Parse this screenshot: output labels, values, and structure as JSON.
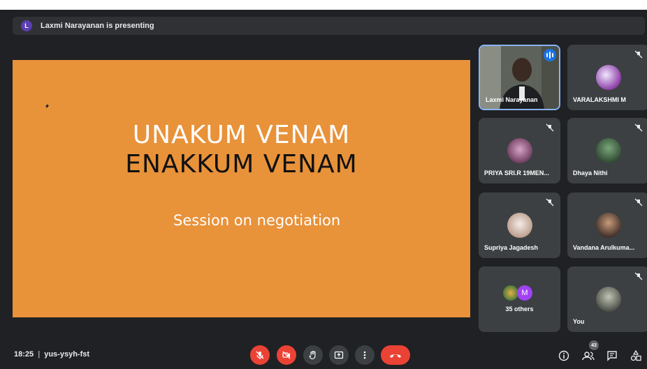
{
  "presenting_bar": {
    "avatar_letter": "L",
    "text": "Laxmi Narayanan is presenting"
  },
  "slide": {
    "title_line1": "UNAKUM VENAM",
    "title_line2": "ENAKKUM VENAM",
    "subtitle": "Session on negotiation"
  },
  "participants": [
    {
      "name": "Laxmi Narayanan",
      "speaking": true
    },
    {
      "name": "VARALAKSHMI M",
      "muted": true
    },
    {
      "name": "PRIYA SRI.R 19MEN...",
      "muted": true
    },
    {
      "name": "Dhaya Nithi",
      "muted": true
    },
    {
      "name": "Supriya Jagadesh",
      "muted": true
    },
    {
      "name": "Vandana Arulkuma...",
      "muted": true
    },
    {
      "name": "35 others",
      "avatar_letter": "M"
    },
    {
      "name": "You",
      "muted": true
    }
  ],
  "bottom_bar": {
    "time": "18:25",
    "meeting_code": "yus-ysyh-fst",
    "people_count": "43"
  },
  "colors": {
    "background": "#202124",
    "slide": "#e8923a",
    "tile": "#3c4043",
    "danger": "#ea4335",
    "speaking": "#1a73e8"
  }
}
